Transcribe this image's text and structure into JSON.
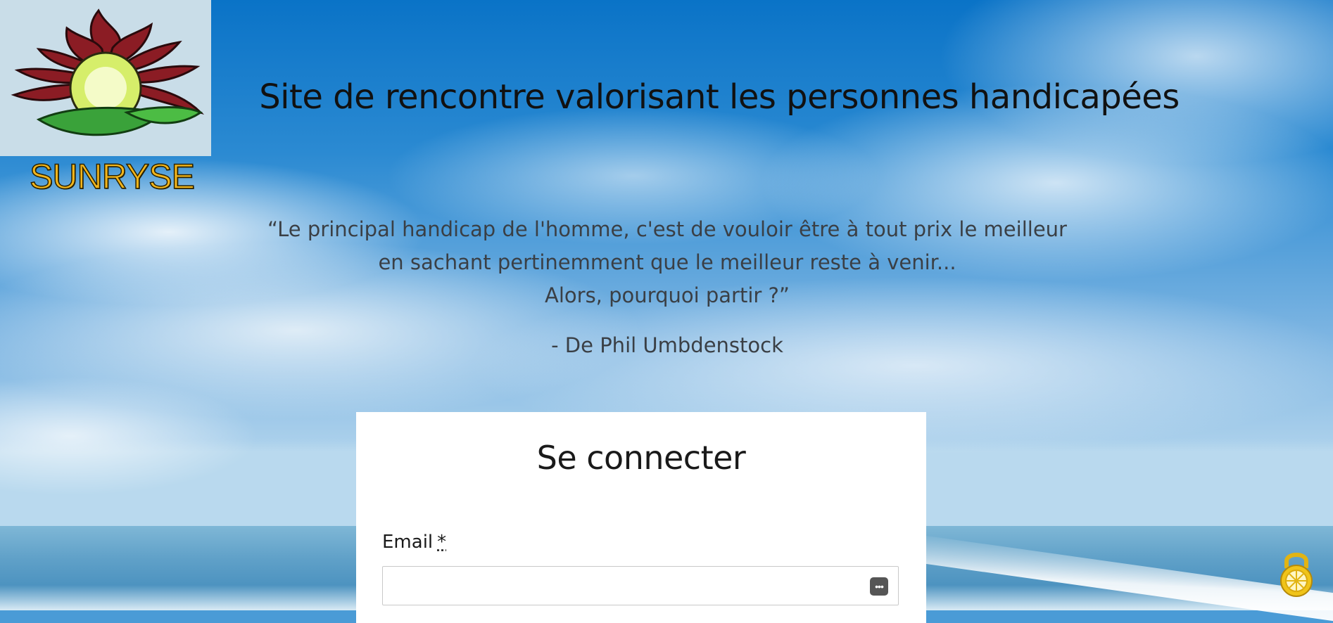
{
  "brand": {
    "name": "SUNRYSE"
  },
  "header": {
    "title": "Site de rencontre valorisant les personnes handicapées"
  },
  "quote": {
    "line1": "“Le principal handicap de l'homme, c'est de vouloir être à tout prix le meilleur",
    "line2": "en sachant pertinemment que le meilleur reste à venir...",
    "line3": "Alors, pourquoi partir ?”",
    "author": "- De Phil Umbdenstock"
  },
  "login": {
    "title": "Se connecter",
    "email_label": "Email",
    "required_mark": "*",
    "email_value": "",
    "password_manager_glyph": "•••"
  },
  "icons": {
    "logo": "flower-sun-logo-icon",
    "lock": "padlock-icon",
    "password_manager": "password-manager-icon"
  },
  "colors": {
    "brand_text": "#f2b51c",
    "logo_petals": "#8b1c24",
    "logo_leaves": "#3aa23a",
    "lock": "#f0c419"
  }
}
